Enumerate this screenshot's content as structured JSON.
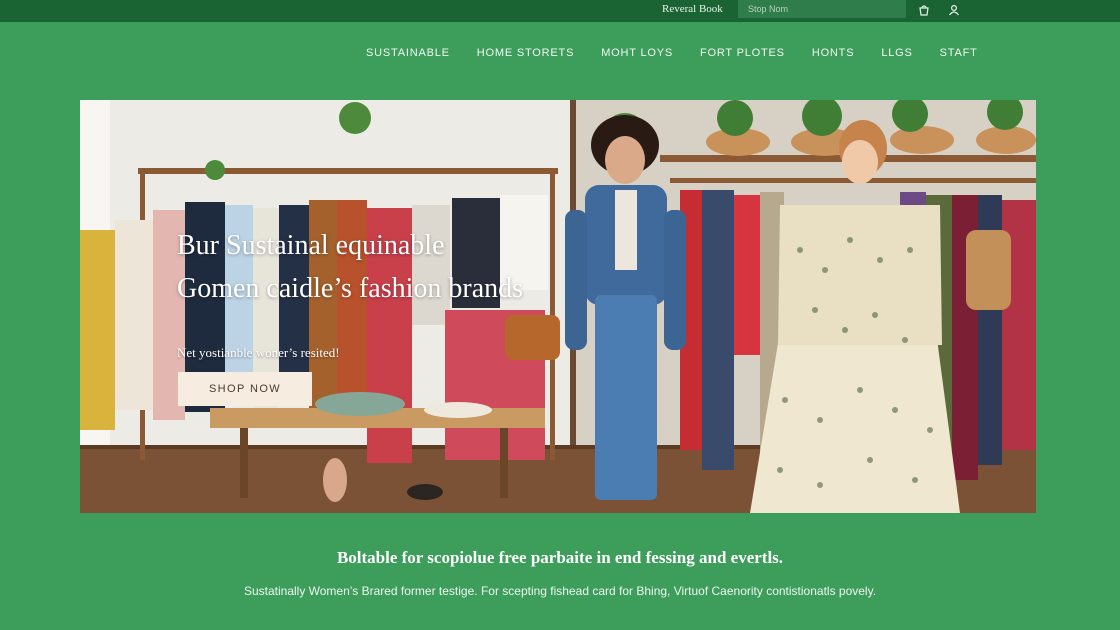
{
  "topbar": {
    "brand_link": "Reveral Book",
    "search_placeholder": "Stop Nom",
    "icons": [
      "bag-icon",
      "user-icon"
    ]
  },
  "nav": {
    "items": [
      "SUSTAINABLE",
      "HOME STORETS",
      "MOHT LOYS",
      "FORT PLOTES",
      "HONTS",
      "LLGS",
      "STAFT"
    ]
  },
  "hero": {
    "title_line1": "Bur Sustainal equinable",
    "title_line2": "Gomen caidle’s fashion brands",
    "subtitle": "Net yostianble woner’s resited!",
    "cta_label": "SHOP NOW"
  },
  "content": {
    "headline": "Boltable for scopiolue free parbaite in end fessing and evertls.",
    "description": "Sustatinally Women’s Brared former testige. For scepting fishead card for Bhing, Virtuof Caenority contistionatls povely."
  },
  "colors": {
    "page_bg": "#3d9e5c",
    "topbar_bg": "#1a6434",
    "cta_bg": "#f6ede0"
  }
}
